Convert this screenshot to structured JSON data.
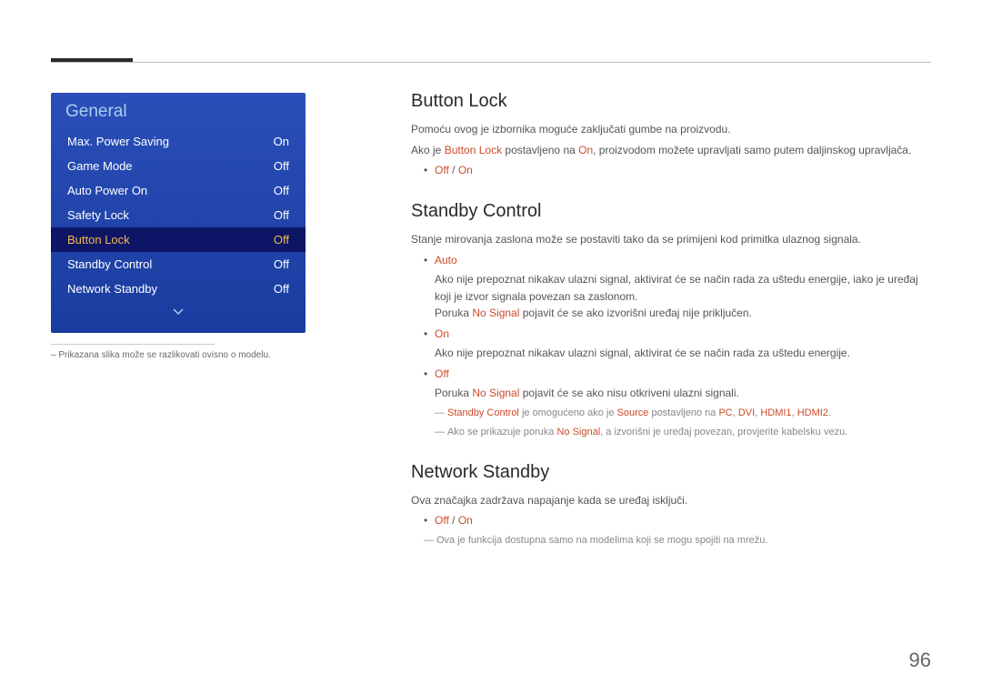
{
  "page_number": "96",
  "menu": {
    "title": "General",
    "items": [
      {
        "label": "Max. Power Saving",
        "value": "On",
        "selected": false
      },
      {
        "label": "Game Mode",
        "value": "Off",
        "selected": false
      },
      {
        "label": "Auto Power On",
        "value": "Off",
        "selected": false
      },
      {
        "label": "Safety Lock",
        "value": "Off",
        "selected": false
      },
      {
        "label": "Button Lock",
        "value": "Off",
        "selected": true
      },
      {
        "label": "Standby Control",
        "value": "Off",
        "selected": false
      },
      {
        "label": "Network Standby",
        "value": "Off",
        "selected": false
      }
    ],
    "footnote_dash": "–",
    "footnote": "Prikazana slika može se razlikovati ovisno o modelu."
  },
  "section1": {
    "heading": "Button Lock",
    "p1": "Pomoću ovog je izbornika moguće zaključati gumbe na proizvodu.",
    "p2_a": "Ako je ",
    "p2_b": "Button Lock",
    "p2_c": " postavljeno na ",
    "p2_d": "On",
    "p2_e": ", proizvodom možete upravljati samo putem daljinskog upravljača.",
    "opt_off": "Off",
    "opt_sep": " / ",
    "opt_on": "On"
  },
  "section2": {
    "heading": "Standby Control",
    "p1": "Stanje mirovanja zaslona može se postaviti tako da se primijeni kod primitka ulaznog signala.",
    "auto_label": "Auto",
    "auto_p1": "Ako nije prepoznat nikakav ulazni signal, aktivirat će se način rada za uštedu energije, iako je uređaj koji je izvor signala povezan sa zaslonom.",
    "auto_p2_a": "Poruka ",
    "auto_p2_b": "No Signal",
    "auto_p2_c": " pojavit će se ako izvorišni uređaj nije priključen.",
    "on_label": "On",
    "on_p1": "Ako nije prepoznat nikakav ulazni signal, aktivirat će se način rada za uštedu energije.",
    "off_label": "Off",
    "off_p1_a": "Poruka ",
    "off_p1_b": "No Signal",
    "off_p1_c": " pojavit će se ako nisu otkriveni ulazni signali.",
    "note1_a": "Standby Control",
    "note1_b": " je omogućeno ako je ",
    "note1_c": "Source",
    "note1_d": " postavljeno na ",
    "note1_pc": "PC",
    "note1_s1": ", ",
    "note1_dvi": "DVI",
    "note1_s2": ", ",
    "note1_h1": "HDMI1",
    "note1_s3": ", ",
    "note1_h2": "HDMI2",
    "note1_end": ".",
    "note2_a": "Ako se prikazuje poruka ",
    "note2_b": "No Signal",
    "note2_c": ", a izvorišni je uređaj povezan, provjerite kabelsku vezu."
  },
  "section3": {
    "heading": "Network Standby",
    "p1": "Ova značajka zadržava napajanje kada se uređaj isključi.",
    "opt_off": "Off",
    "opt_sep": " / ",
    "opt_on": "On",
    "note": "Ova je funkcija dostupna samo na modelima koji se mogu spojiti na mrežu."
  }
}
